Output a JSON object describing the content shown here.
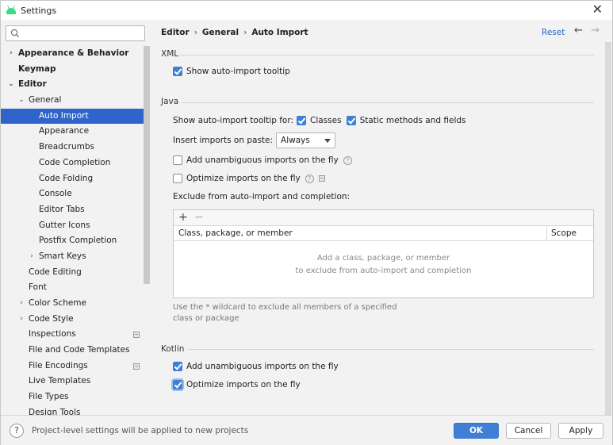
{
  "window": {
    "title": "Settings",
    "accent_color": "#2f65ca",
    "close_icon": "close-icon"
  },
  "search": {
    "placeholder": "Q▾",
    "value": ""
  },
  "sidebar": {
    "items": [
      {
        "label": "Appearance & Behavior",
        "level": 0,
        "bold": true,
        "arrow": "›",
        "selected": false,
        "project_icon": false
      },
      {
        "label": "Keymap",
        "level": 0,
        "bold": true,
        "arrow": "",
        "selected": false,
        "project_icon": false
      },
      {
        "label": "Editor",
        "level": 0,
        "bold": true,
        "arrow": "⌄",
        "selected": false,
        "project_icon": false
      },
      {
        "label": "General",
        "level": 1,
        "bold": false,
        "arrow": "⌄",
        "selected": false,
        "project_icon": false
      },
      {
        "label": "Auto Import",
        "level": 2,
        "bold": false,
        "arrow": "",
        "selected": true,
        "project_icon": false
      },
      {
        "label": "Appearance",
        "level": 2,
        "bold": false,
        "arrow": "",
        "selected": false,
        "project_icon": false
      },
      {
        "label": "Breadcrumbs",
        "level": 2,
        "bold": false,
        "arrow": "",
        "selected": false,
        "project_icon": false
      },
      {
        "label": "Code Completion",
        "level": 2,
        "bold": false,
        "arrow": "",
        "selected": false,
        "project_icon": false
      },
      {
        "label": "Code Folding",
        "level": 2,
        "bold": false,
        "arrow": "",
        "selected": false,
        "project_icon": false
      },
      {
        "label": "Console",
        "level": 2,
        "bold": false,
        "arrow": "",
        "selected": false,
        "project_icon": false
      },
      {
        "label": "Editor Tabs",
        "level": 2,
        "bold": false,
        "arrow": "",
        "selected": false,
        "project_icon": false
      },
      {
        "label": "Gutter Icons",
        "level": 2,
        "bold": false,
        "arrow": "",
        "selected": false,
        "project_icon": false
      },
      {
        "label": "Postfix Completion",
        "level": 2,
        "bold": false,
        "arrow": "",
        "selected": false,
        "project_icon": false
      },
      {
        "label": "Smart Keys",
        "level": 2,
        "bold": false,
        "arrow": "›",
        "selected": false,
        "project_icon": false
      },
      {
        "label": "Code Editing",
        "level": 1,
        "bold": false,
        "arrow": "",
        "selected": false,
        "project_icon": false
      },
      {
        "label": "Font",
        "level": 1,
        "bold": false,
        "arrow": "",
        "selected": false,
        "project_icon": false
      },
      {
        "label": "Color Scheme",
        "level": 1,
        "bold": false,
        "arrow": "›",
        "selected": false,
        "project_icon": false
      },
      {
        "label": "Code Style",
        "level": 1,
        "bold": false,
        "arrow": "›",
        "selected": false,
        "project_icon": false
      },
      {
        "label": "Inspections",
        "level": 1,
        "bold": false,
        "arrow": "",
        "selected": false,
        "project_icon": true
      },
      {
        "label": "File and Code Templates",
        "level": 1,
        "bold": false,
        "arrow": "",
        "selected": false,
        "project_icon": false
      },
      {
        "label": "File Encodings",
        "level": 1,
        "bold": false,
        "arrow": "",
        "selected": false,
        "project_icon": true
      },
      {
        "label": "Live Templates",
        "level": 1,
        "bold": false,
        "arrow": "",
        "selected": false,
        "project_icon": false
      },
      {
        "label": "File Types",
        "level": 1,
        "bold": false,
        "arrow": "",
        "selected": false,
        "project_icon": false
      },
      {
        "label": "Design Tools",
        "level": 1,
        "bold": false,
        "arrow": "",
        "selected": false,
        "project_icon": false
      }
    ]
  },
  "header": {
    "breadcrumb": [
      "Editor",
      "General",
      "Auto Import"
    ],
    "breadcrumb_separator": "›",
    "reset_label": "Reset",
    "back_arrow": "←",
    "forward_arrow": "→"
  },
  "xml_section": {
    "title": "XML",
    "show_tooltip": {
      "label": "Show auto-import tooltip",
      "checked": true
    }
  },
  "java_section": {
    "title": "Java",
    "tooltip_for_label": "Show auto-import tooltip for:",
    "classes": {
      "label": "Classes",
      "checked": true
    },
    "static_members": {
      "label": "Static methods and fields",
      "checked": true
    },
    "insert_on_paste_label": "Insert imports on paste:",
    "insert_on_paste_value": "Always",
    "add_unambiguous": {
      "label": "Add unambiguous imports on the fly",
      "checked": false
    },
    "optimize_imports": {
      "label": "Optimize imports on the fly",
      "checked": false
    },
    "exclude_label": "Exclude from auto-import and completion:",
    "table": {
      "add_symbol": "+",
      "remove_symbol": "−",
      "columns": [
        "Class, package, or member",
        "Scope"
      ],
      "empty_line1": "Add a class, package, or member",
      "empty_line2": "to exclude from auto-import and completion"
    },
    "hint": "Use the * wildcard to exclude all members of a specified class or package"
  },
  "kotlin_section": {
    "title": "Kotlin",
    "add_unambiguous": {
      "label": "Add unambiguous imports on the fly",
      "checked": true
    },
    "optimize_imports": {
      "label": "Optimize imports on the fly",
      "checked": true
    }
  },
  "footer": {
    "help_symbol": "?",
    "text": "Project-level settings will be applied to new projects",
    "ok_label": "OK",
    "cancel_label": "Cancel",
    "apply_label": "Apply"
  }
}
